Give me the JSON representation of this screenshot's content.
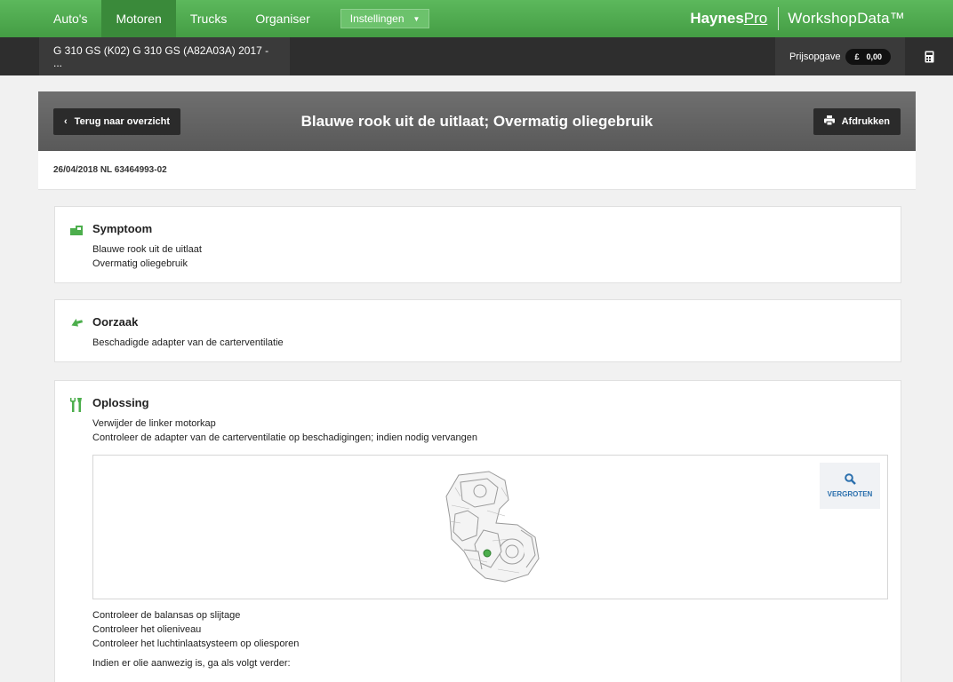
{
  "nav": {
    "items": [
      "Auto's",
      "Motoren",
      "Trucks",
      "Organiser"
    ],
    "active": "Motoren",
    "settings_label": "Instellingen",
    "brand_haynes": "Haynes",
    "brand_pro": "Pro",
    "brand_product": "WorkshopData™"
  },
  "vehicle_bar": {
    "vehicle": "G 310 GS (K02) G 310 GS (A82A03A) 2017 - ...",
    "quote_label": "Prijsopgave",
    "quote_currency": "£",
    "quote_value": "0,00"
  },
  "page": {
    "back_label": "Terug naar overzicht",
    "title": "Blauwe rook uit de uitlaat; Overmatig oliegebruik",
    "print_label": "Afdrukken",
    "doc_ref": "26/04/2018 NL 63464993-02"
  },
  "symptom": {
    "heading": "Symptoom",
    "lines": [
      "Blauwe rook uit de uitlaat",
      "Overmatig oliegebruik"
    ]
  },
  "cause": {
    "heading": "Oorzaak",
    "lines": [
      "Beschadigde adapter van de carterventilatie"
    ]
  },
  "solution": {
    "heading": "Oplossing",
    "lines": [
      "Verwijder de linker motorkap",
      "Controleer de adapter van de carterventilatie op beschadigingen; indien nodig vervangen"
    ],
    "zoom_label": "VERGROTEN",
    "after_lines": [
      "Controleer de balansas op slijtage",
      "Controleer het olieniveau",
      "Controleer het luchtinlaatsysteem op oliesporen"
    ],
    "after_lines2": [
      "Indien er olie aanwezig is, ga als volgt verder:"
    ]
  },
  "colors": {
    "green": "#4cae4c",
    "accent_blue": "#2a6fad"
  }
}
